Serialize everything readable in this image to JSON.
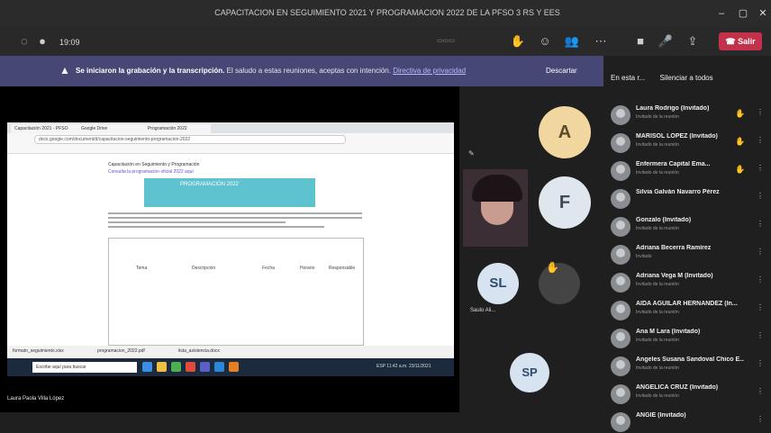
{
  "window": {
    "title": "CAPACITACION EN SEGUIMIENTO 2021 Y PROGRAMACION 2022 DE LA PFSO 3 RS Y EES"
  },
  "toolbar": {
    "timer": "19:09",
    "leave_label": "Salir",
    "colors": {
      "leave": "#c4314b",
      "toolbar": "#292929"
    }
  },
  "banner": {
    "bold": "Se iniciaron la grabación y la transcripción.",
    "text": "El saludo a estas reuniones, aceptas con intención.",
    "link": "Directiva de privacidad",
    "dismiss": "Descartar",
    "color": "#464775"
  },
  "shared_screen": {
    "browser_tabs": [
      "Capacitación 2021 - PFSO",
      "Google Drive",
      "Programación 2022"
    ],
    "url": "docs.google.com/document/d/capacitacion-seguimiento-programacion-2022",
    "doc_title": "Capacitación en Seguimiento y Programación",
    "doc_link": "Consulta la programación oficial 2022 aquí",
    "banner_text": "PROGRAMACIÓN 2022",
    "table_headers": [
      "Tema",
      "Descripción",
      "Fecha",
      "Horario",
      "Responsable"
    ],
    "downloads": [
      "formato_seguimiento.xlsx",
      "programacion_2022.pdf",
      "lista_asistencia.docx"
    ],
    "taskbar_search": "Escribe aquí para buscar",
    "tray": "ESP 11:42 a.m. 23/11/2021",
    "presenter": "Laura Paola Villa López"
  },
  "videos": [
    {
      "initials": "A",
      "color": "#f2d6a0"
    },
    {
      "initials": "F",
      "color": "#dfe6ee"
    },
    {
      "initials": "SL",
      "color": "#d7e3f0",
      "label": "Saulo Ali..."
    },
    {
      "initials": "SP",
      "color": "#d7e3f0"
    }
  ],
  "roster": {
    "header": "En esta r...",
    "mute_all": "Silenciar a todos",
    "participants": [
      {
        "name": "Laura Rodrigo (Invitado)",
        "role": "Invitado de la reunión",
        "hand": true
      },
      {
        "name": "MARISOL LÓPEZ (Invitado)",
        "role": "Invitado de la reunión",
        "hand": true
      },
      {
        "name": "Enfermera Capital Ema...",
        "role": "Invitado de la reunión",
        "hand": true
      },
      {
        "name": "Silvia Galván Navarro Pérez",
        "role": "",
        "hand": false
      },
      {
        "name": "Gonzalo (Invitado)",
        "role": "Invitado de la reunión",
        "hand": false
      },
      {
        "name": "Adriana Becerra Ramírez",
        "role": "Invitado",
        "hand": false
      },
      {
        "name": "Adriana Vega M (Invitado)",
        "role": "Invitado de la reunión",
        "hand": false
      },
      {
        "name": "AIDA AGUILAR HERNÁNDEZ (In...",
        "role": "Invitado de la reunión",
        "hand": false
      },
      {
        "name": "Ana M Lara (Invitado)",
        "role": "Invitado de la reunión",
        "hand": false
      },
      {
        "name": "Ángeles Susana Sandoval Chico E...",
        "role": "Invitado de la reunión",
        "hand": false
      },
      {
        "name": "ANGELICA CRUZ (Invitado)",
        "role": "Invitado de la reunión",
        "hand": false
      },
      {
        "name": "ANGIE (Invitado)",
        "role": "",
        "hand": false
      }
    ]
  }
}
